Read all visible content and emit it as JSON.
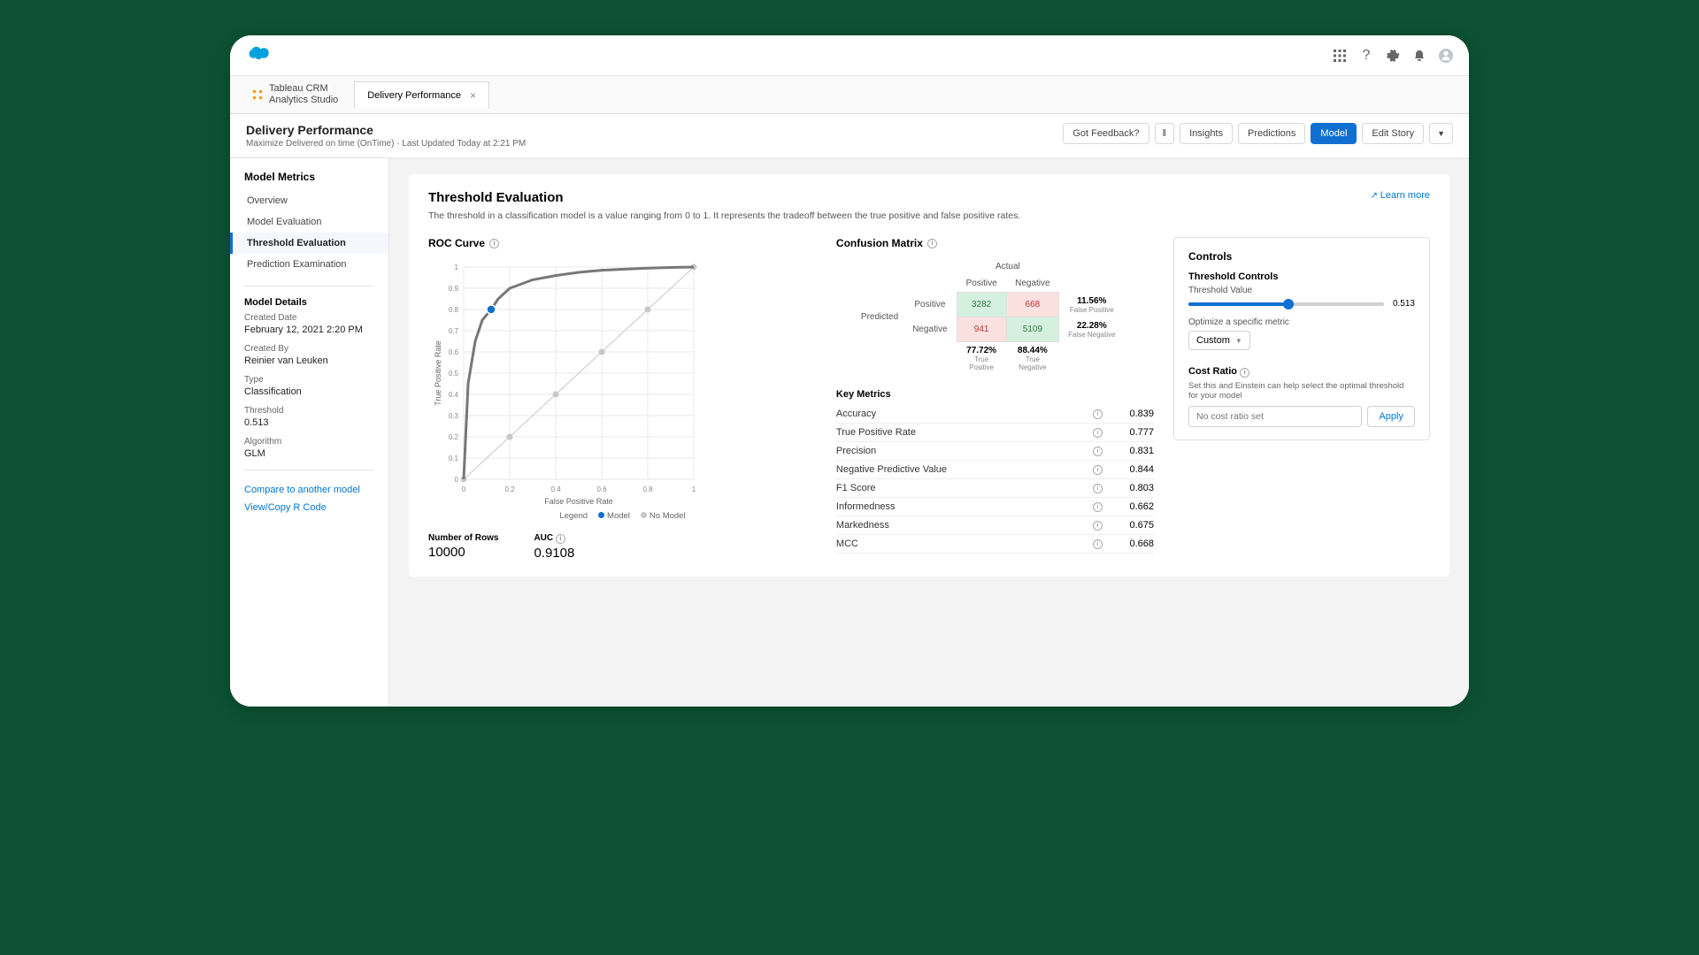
{
  "header": {
    "icons": {
      "apps": "apps-icon",
      "help": "help-icon",
      "setup": "gear-icon",
      "notifications": "bell-icon",
      "avatar": "avatar-icon"
    }
  },
  "workspace": {
    "product_line1": "Tableau CRM",
    "product_line2": "Analytics Studio",
    "tab_label": "Delivery Performance"
  },
  "page": {
    "title": "Delivery Performance",
    "subtitle": "Maximize Delivered on time (OnTime) · Last Updated Today at 2:21 PM",
    "actions": {
      "feedback": "Got Feedback?",
      "insights": "Insights",
      "predictions": "Predictions",
      "model": "Model",
      "edit_story": "Edit Story"
    }
  },
  "sidebar": {
    "metrics_heading": "Model Metrics",
    "nav": [
      {
        "label": "Overview"
      },
      {
        "label": "Model Evaluation"
      },
      {
        "label": "Threshold Evaluation",
        "active": true
      },
      {
        "label": "Prediction Examination"
      }
    ],
    "details_heading": "Model Details",
    "details": {
      "created_date_label": "Created Date",
      "created_date": "February 12, 2021 2:20 PM",
      "created_by_label": "Created By",
      "created_by": "Reinier van Leuken",
      "type_label": "Type",
      "type": "Classification",
      "threshold_label": "Threshold",
      "threshold": "0.513",
      "algorithm_label": "Algorithm",
      "algorithm": "GLM"
    },
    "links": {
      "compare": "Compare to another model",
      "rcode": "View/Copy R Code"
    }
  },
  "section": {
    "title": "Threshold Evaluation",
    "learn_more": "Learn more",
    "description": "The threshold in a classification model is a value ranging from 0 to 1. It represents the tradeoff between the true positive and false positive rates."
  },
  "roc": {
    "title": "ROC Curve",
    "xlabel": "False Positive Rate",
    "ylabel": "True Positive Rate",
    "legend_label": "Legend",
    "legend_model": "Model",
    "legend_no_model": "No Model",
    "stats": {
      "rows_label": "Number of Rows",
      "rows": "10000",
      "auc_label": "AUC",
      "auc": "0.9108"
    }
  },
  "confusion": {
    "title": "Confusion Matrix",
    "actual": "Actual",
    "predicted": "Predicted",
    "positive": "Positive",
    "negative": "Negative",
    "tp": "3282",
    "fp": "668",
    "fn": "941",
    "tn": "5109",
    "fp_rate": "11.56%",
    "fp_rate_label": "False Positive",
    "fn_rate": "22.28%",
    "fn_rate_label": "False Negative",
    "tp_col_rate": "77.72%",
    "tp_col_label": "True Positive",
    "tn_col_rate": "88.44%",
    "tn_col_label": "True Negative"
  },
  "key_metrics": {
    "title": "Key Metrics",
    "rows": [
      {
        "name": "Accuracy",
        "value": "0.839"
      },
      {
        "name": "True Positive Rate",
        "value": "0.777"
      },
      {
        "name": "Precision",
        "value": "0.831"
      },
      {
        "name": "Negative Predictive Value",
        "value": "0.844"
      },
      {
        "name": "F1 Score",
        "value": "0.803"
      },
      {
        "name": "Informedness",
        "value": "0.662"
      },
      {
        "name": "Markedness",
        "value": "0.675"
      },
      {
        "name": "MCC",
        "value": "0.668"
      }
    ]
  },
  "controls": {
    "heading": "Controls",
    "threshold_controls": "Threshold Controls",
    "threshold_value_label": "Threshold Value",
    "threshold_value": "0.513",
    "optimize_label": "Optimize a specific metric",
    "optimize_selected": "Custom",
    "cost_ratio_label": "Cost Ratio",
    "cost_ratio_desc": "Set this and Einstein can help select the optimal threshold for your model",
    "cost_ratio_placeholder": "No cost ratio set",
    "apply": "Apply"
  },
  "chart_data": {
    "type": "line",
    "title": "ROC Curve",
    "xlabel": "False Positive Rate",
    "ylabel": "True Positive Rate",
    "xlim": [
      0,
      1
    ],
    "ylim": [
      0,
      1
    ],
    "xticks": [
      0,
      0.2,
      0.4,
      0.6,
      0.8,
      1
    ],
    "yticks": [
      0,
      0.1,
      0.2,
      0.3,
      0.4,
      0.5,
      0.6,
      0.7,
      0.8,
      0.9,
      1
    ],
    "series": [
      {
        "name": "Model",
        "x": [
          0,
          0.02,
          0.05,
          0.08,
          0.12,
          0.15,
          0.2,
          0.3,
          0.4,
          0.5,
          0.6,
          0.7,
          0.8,
          0.9,
          1
        ],
        "y": [
          0,
          0.45,
          0.65,
          0.75,
          0.8,
          0.85,
          0.9,
          0.94,
          0.96,
          0.975,
          0.985,
          0.99,
          0.995,
          0.998,
          1
        ]
      },
      {
        "name": "No Model",
        "x": [
          0,
          0.2,
          0.4,
          0.6,
          0.8,
          1
        ],
        "y": [
          0,
          0.2,
          0.4,
          0.6,
          0.8,
          1
        ]
      }
    ],
    "operating_point": {
      "x": 0.12,
      "y": 0.8
    },
    "auc": 0.9108
  }
}
